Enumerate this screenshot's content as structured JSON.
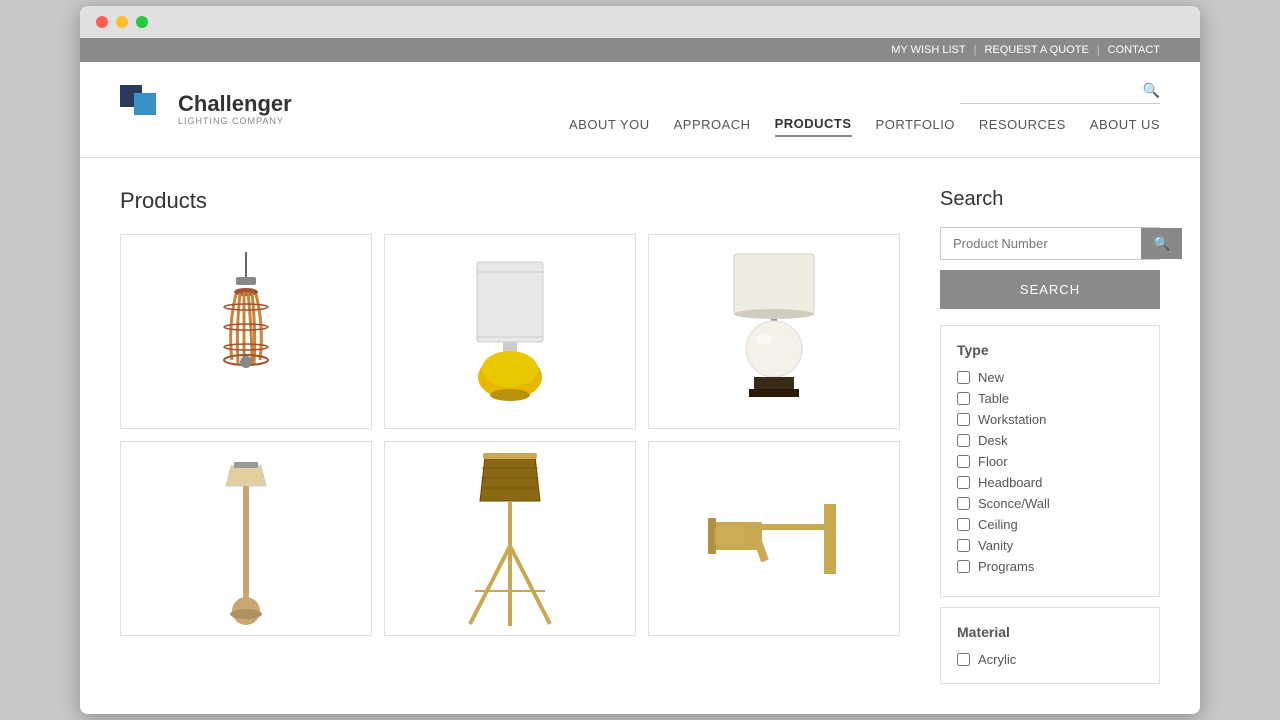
{
  "browser": {
    "dots": [
      "red",
      "yellow",
      "green"
    ]
  },
  "topbar": {
    "links": [
      "MY WISH LIST",
      "REQUEST A QUOTE",
      "CONTACT"
    ],
    "separators": [
      "|",
      "|"
    ]
  },
  "header": {
    "logo": {
      "main": "Challenger",
      "sub": "LIGHTING COMPANY"
    },
    "search_placeholder": "",
    "nav_items": [
      {
        "label": "ABOUT YOU",
        "active": false
      },
      {
        "label": "APPROACH",
        "active": false
      },
      {
        "label": "PRODUCTS",
        "active": true
      },
      {
        "label": "PORTFOLIO",
        "active": false
      },
      {
        "label": "RESOURCES",
        "active": false
      },
      {
        "label": "ABOUT US",
        "active": false
      }
    ]
  },
  "products": {
    "title": "Products",
    "grid": [
      {
        "id": "pendant",
        "type": "pendant"
      },
      {
        "id": "table-yellow",
        "type": "table-yellow"
      },
      {
        "id": "globe",
        "type": "globe"
      },
      {
        "id": "floor-thin",
        "type": "floor-thin"
      },
      {
        "id": "tripod",
        "type": "tripod"
      },
      {
        "id": "swing-arm",
        "type": "swing-arm"
      }
    ]
  },
  "sidebar": {
    "title": "Search",
    "product_number_placeholder": "Product Number",
    "search_button_label": "SEARCH",
    "filter_section_title": "Type",
    "filter_items": [
      {
        "label": "New",
        "checked": false
      },
      {
        "label": "Table",
        "checked": false
      },
      {
        "label": "Workstation",
        "checked": false
      },
      {
        "label": "Desk",
        "checked": false
      },
      {
        "label": "Floor",
        "checked": false
      },
      {
        "label": "Headboard",
        "checked": false
      },
      {
        "label": "Sconce/Wall",
        "checked": false
      },
      {
        "label": "Ceiling",
        "checked": false
      },
      {
        "label": "Vanity",
        "checked": false
      },
      {
        "label": "Programs",
        "checked": false
      }
    ],
    "material_section_title": "Material",
    "material_items": [
      {
        "label": "Acrylic",
        "checked": false
      }
    ]
  }
}
